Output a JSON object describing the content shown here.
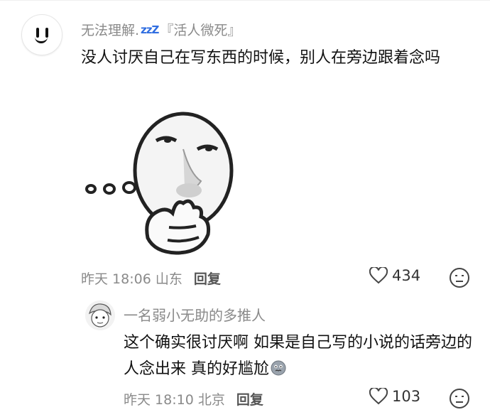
{
  "comment": {
    "username_prefix": "无法理解.",
    "username_zzz": "zzZ",
    "username_suffix": "『活人微死』",
    "text": "没人讨厌自己在写东西的时候，别人在旁边跟着念吗",
    "time": "昨天 18:06",
    "location": "山东",
    "reply_label": "回复",
    "likes": "434"
  },
  "reply": {
    "username": "一名弱小无助的多推人",
    "text": "这个确实很讨厌啊 如果是自己写的小说的话旁边的人念出来 真的好尴尬",
    "emoji": "awkward-face-emoji",
    "time": "昨天 18:10",
    "location": "北京",
    "reply_label": "回复",
    "likes": "103"
  },
  "icons": {
    "like": "heart-outline-icon",
    "dislike": "dislike-face-icon"
  },
  "colors": {
    "meta_gray": "#8a8a8a",
    "text": "#111111",
    "zzz_blue": "#2f6de0"
  }
}
